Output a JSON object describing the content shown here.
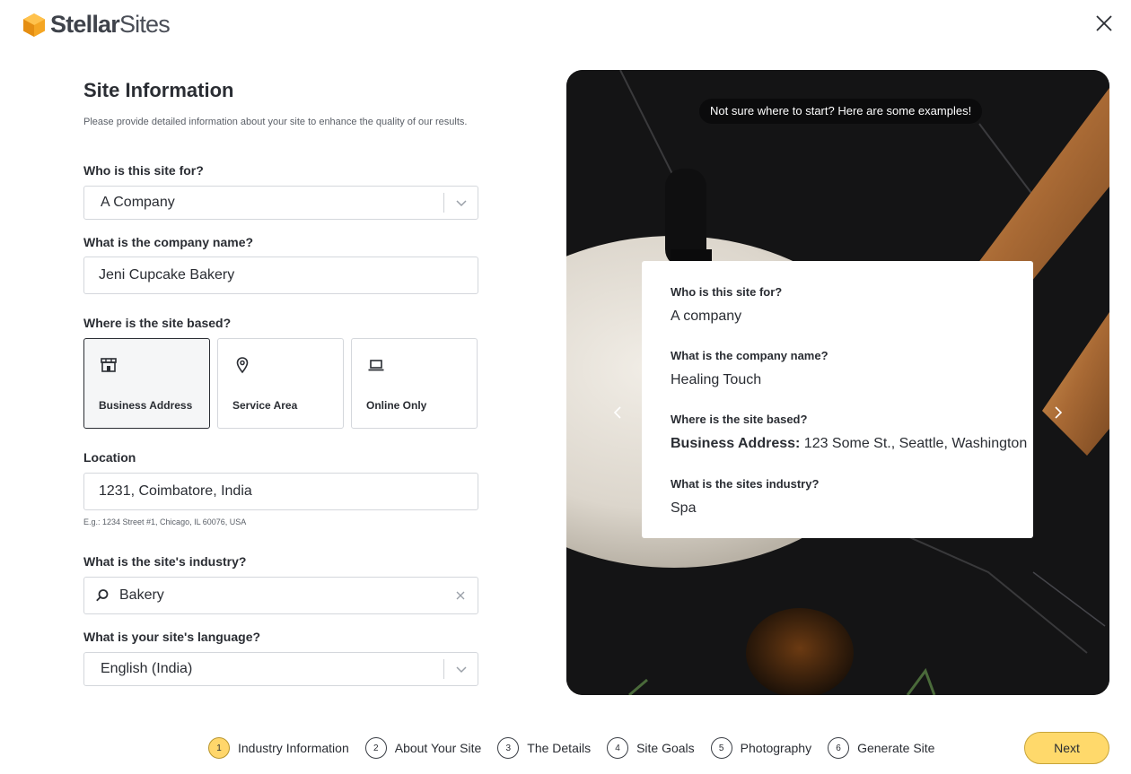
{
  "brand": {
    "name_part1": "Stellar",
    "name_part2": "Sites",
    "logo_color": "#f5a623"
  },
  "form": {
    "title": "Site Information",
    "description": "Please provide detailed information about your site to enhance the quality of our results.",
    "who_label": "Who is this site for?",
    "who_value": "A Company",
    "company_label": "What is the company name?",
    "company_value": "Jeni Cupcake Bakery",
    "based_label": "Where is the site based?",
    "based_options": [
      {
        "label": "Business Address",
        "icon": "store-icon",
        "selected": true
      },
      {
        "label": "Service Area",
        "icon": "map-pin-icon",
        "selected": false
      },
      {
        "label": "Online Only",
        "icon": "laptop-icon",
        "selected": false
      }
    ],
    "location_label": "Location",
    "location_value": "1231, Coimbatore, India",
    "location_hint": "E.g.: 1234 Street #1, Chicago, IL 60076, USA",
    "industry_label": "What is the site's industry?",
    "industry_value": "Bakery",
    "language_label": "What is your site's language?",
    "language_value": "English (India)"
  },
  "preview": {
    "tip": "Not sure where to start? Here are some examples!",
    "example": {
      "q1": "Who is this site for?",
      "a1": "A company",
      "q2": "What is the company name?",
      "a2": "Healing Touch",
      "q3": "Where is the site based?",
      "a3_prefix": "Business Address:",
      "a3": " 123 Some St., Seattle, Washington",
      "q4": "What is the sites industry?",
      "a4": "Spa"
    }
  },
  "steps": [
    {
      "num": "1",
      "label": "Industry Information",
      "current": true
    },
    {
      "num": "2",
      "label": "About Your Site",
      "current": false
    },
    {
      "num": "3",
      "label": "The Details",
      "current": false
    },
    {
      "num": "4",
      "label": "Site Goals",
      "current": false
    },
    {
      "num": "5",
      "label": "Photography",
      "current": false
    },
    {
      "num": "6",
      "label": "Generate Site",
      "current": false
    }
  ],
  "next_label": "Next",
  "accent": "#ffd96b"
}
